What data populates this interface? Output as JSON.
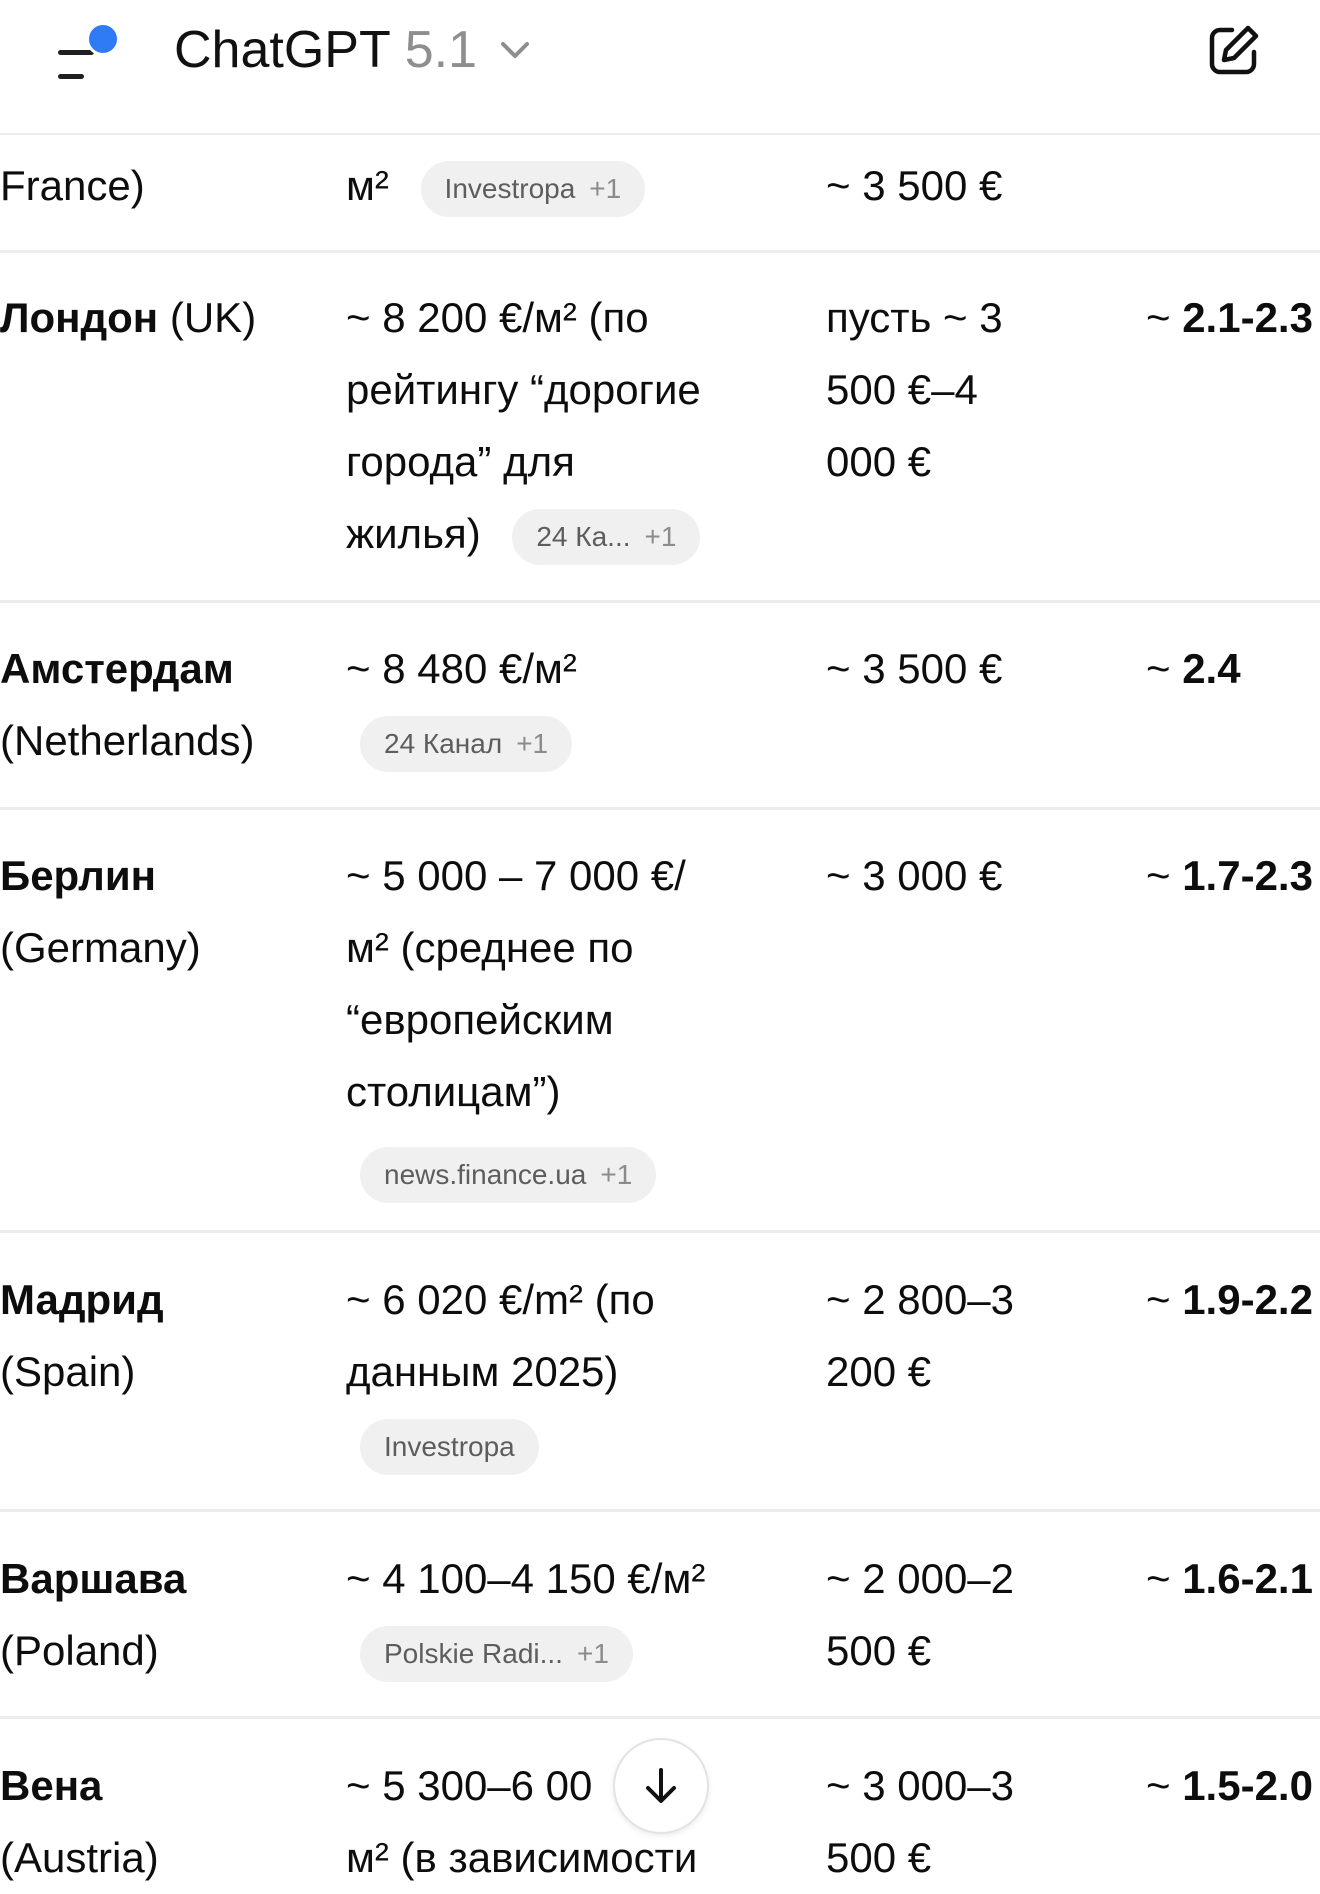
{
  "header": {
    "model_name": "ChatGPT",
    "model_version": "5.1",
    "accent_dot_color": "#2f7bf5",
    "icons": {
      "menu": "sidebar-menu-icon",
      "model_dropdown": "chevron-down-icon",
      "new_chat": "edit-compose-icon"
    }
  },
  "rows": [
    {
      "city_line1": "",
      "city_line2": "France)",
      "price_lines": [
        "м²"
      ],
      "chip": {
        "label": "Investropa",
        "extra": "+1"
      },
      "salary_lines": [
        "~ 3 500 €"
      ],
      "ratio": ""
    },
    {
      "city_bold": "Лондон",
      "city_rest": " (UK)",
      "price_lines": [
        "~ 8 200 €/м² (по",
        "рейтингу “дорогие",
        "города” для",
        "жилья)"
      ],
      "chip": {
        "label": "24 Ка...",
        "extra": "+1"
      },
      "salary_lines": [
        "пусть ~ 3",
        "500 €–4",
        "000 €"
      ],
      "ratio_prefix": "~ ",
      "ratio": "2.1-2.3"
    },
    {
      "city_bold": "Амстердам",
      "city_line2": "(Netherlands)",
      "price_lines": [
        "~ 8 480 €/м²"
      ],
      "chip": {
        "label": "24 Канал",
        "extra": "+1"
      },
      "salary_lines": [
        "~ 3 500 €"
      ],
      "ratio_prefix": "~ ",
      "ratio": "2.4"
    },
    {
      "city_bold": "Берлин",
      "city_line2": "(Germany)",
      "price_lines": [
        "~ 5 000 – 7 000 €/",
        "м² (среднее по",
        "“европейским",
        "столицам”)"
      ],
      "chip": {
        "label": "news.finance.ua",
        "extra": "+1"
      },
      "salary_lines": [
        "~ 3 000 €"
      ],
      "ratio_prefix": "~ ",
      "ratio": "1.7-2.3"
    },
    {
      "city_bold": "Мадрид",
      "city_line2": "(Spain)",
      "price_lines": [
        "~ 6 020 €/m² (по",
        "данным 2025)"
      ],
      "chip": {
        "label": "Investropa",
        "extra": ""
      },
      "salary_lines": [
        "~ 2 800–3",
        "200 €"
      ],
      "ratio_prefix": "~ ",
      "ratio": "1.9-2.2"
    },
    {
      "city_bold": "Варшава",
      "city_line2": "(Poland)",
      "price_lines": [
        "~ 4 100–4 150 €/м²"
      ],
      "chip": {
        "label": "Polskie Radi...",
        "extra": "+1"
      },
      "salary_lines": [
        "~ 2 000–2",
        "500 €"
      ],
      "ratio_prefix": "~ ",
      "ratio": "1.6-2.1"
    },
    {
      "city_bold": "Вена",
      "city_line2": "(Austria)",
      "price_lines": [
        "~ 5 300–6 00",
        "м² (в зависимости"
      ],
      "salary_lines": [
        "~ 3 000–3",
        "500 €"
      ],
      "ratio_prefix": "~ ",
      "ratio": "1.5-2.0"
    }
  ],
  "scroll_button_icon": "arrow-down-icon"
}
